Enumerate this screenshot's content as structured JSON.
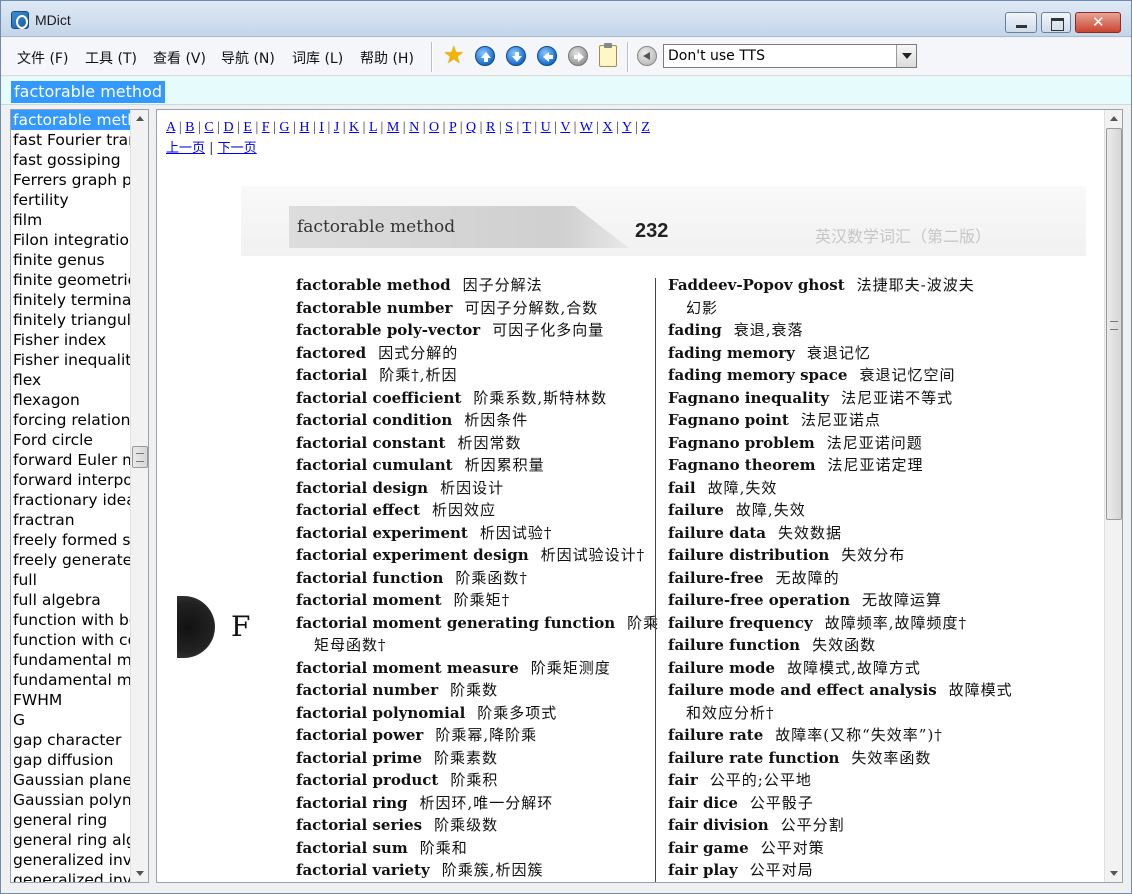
{
  "window": {
    "title": "MDict",
    "min_label": "",
    "max_label": "",
    "close_label": "✕"
  },
  "menu": {
    "file": "文件 (F)",
    "tools": "工具 (T)",
    "view": "查看 (V)",
    "nav": "导航 (N)",
    "library": "词库 (L)",
    "help": "帮助 (H)"
  },
  "toolbar": {
    "icons": [
      "star-icon",
      "arrow-up-icon",
      "arrow-down-icon",
      "back-icon",
      "forward-icon",
      "clipboard-icon",
      "speaker-icon"
    ],
    "tts_value": "Don't use TTS"
  },
  "search": {
    "value": "factorable method"
  },
  "wordlist": [
    "factorable method",
    "fast Fourier transform",
    "fast gossiping",
    "Ferrers graph paper",
    "fertility",
    "film",
    "Filon integration",
    "finite genus",
    "finite geometric",
    "finitely terminating",
    "finitely triangulable",
    "Fisher index",
    "Fisher inequality",
    "flex",
    "flexagon",
    "forcing relation",
    "Ford circle",
    "forward Euler method",
    "forward interpolation",
    "fractionary ideal",
    "fractran",
    "freely formed set",
    "freely generated",
    "full",
    "full algebra",
    "function with bounded",
    "function with compact",
    "fundamental matrix",
    "fundamental mode",
    "FWHM",
    "G",
    "gap character",
    "gap diffusion",
    "Gaussian plane",
    "Gaussian polynomial",
    "general ring",
    "general ring algebra",
    "generalized inverse",
    "generalized inverse"
  ],
  "content": {
    "alphabet": [
      "A",
      "B",
      "C",
      "D",
      "E",
      "F",
      "G",
      "H",
      "I",
      "J",
      "K",
      "L",
      "M",
      "N",
      "O",
      "P",
      "Q",
      "R",
      "S",
      "T",
      "U",
      "V",
      "W",
      "X",
      "Y",
      "Z"
    ],
    "prev_page": "上一页",
    "next_page": "下一页",
    "page_header": {
      "entry": "factorable method",
      "page_number": "232",
      "book_title": "英汉数学词汇（第二版）"
    },
    "thumb_letter": "F",
    "left_column": [
      {
        "hw": "factorable method",
        "def": "因子分解法"
      },
      {
        "hw": "factorable number",
        "def": "可因子分解数,合数"
      },
      {
        "hw": "factorable poly-vector",
        "def": "可因子化多向量"
      },
      {
        "hw": "factored",
        "def": "因式分解的"
      },
      {
        "hw": "factorial",
        "def": "阶乘†,析因"
      },
      {
        "hw": "factorial coefficient",
        "def": "阶乘系数,斯特林数"
      },
      {
        "hw": "factorial condition",
        "def": "析因条件"
      },
      {
        "hw": "factorial constant",
        "def": "析因常数"
      },
      {
        "hw": "factorial cumulant",
        "def": "析因累积量"
      },
      {
        "hw": "factorial design",
        "def": "析因设计"
      },
      {
        "hw": "factorial effect",
        "def": "析因效应"
      },
      {
        "hw": "factorial experiment",
        "def": "析因试验†"
      },
      {
        "hw": "factorial experiment design",
        "def": "析因试验设计†"
      },
      {
        "hw": "factorial function",
        "def": "阶乘函数†"
      },
      {
        "hw": "factorial moment",
        "def": "阶乘矩†"
      },
      {
        "hw": "factorial moment generating function",
        "def": "阶乘",
        "cont": "矩母函数†"
      },
      {
        "hw": "factorial moment measure",
        "def": "阶乘矩测度"
      },
      {
        "hw": "factorial number",
        "def": "阶乘数"
      },
      {
        "hw": "factorial polynomial",
        "def": "阶乘多项式"
      },
      {
        "hw": "factorial power",
        "def": "阶乘幂,降阶乘"
      },
      {
        "hw": "factorial prime",
        "def": "阶乘素数"
      },
      {
        "hw": "factorial product",
        "def": "阶乘积"
      },
      {
        "hw": "factorial ring",
        "def": "析因环,唯一分解环"
      },
      {
        "hw": "factorial series",
        "def": "阶乘级数"
      },
      {
        "hw": "factorial sum",
        "def": "阶乘和"
      },
      {
        "hw": "factorial variety",
        "def": "阶乘簇,析因簇"
      }
    ],
    "right_column": [
      {
        "hw": "Faddeev-Popov ghost",
        "def": "法捷耶夫-波波夫",
        "cont": "幻影"
      },
      {
        "hw": "fading",
        "def": "衰退,衰落"
      },
      {
        "hw": "fading memory",
        "def": "衰退记忆"
      },
      {
        "hw": "fading memory space",
        "def": "衰退记忆空间"
      },
      {
        "hw": "Fagnano inequality",
        "def": "法尼亚诺不等式"
      },
      {
        "hw": "Fagnano point",
        "def": "法尼亚诺点"
      },
      {
        "hw": "Fagnano problem",
        "def": "法尼亚诺问题"
      },
      {
        "hw": "Fagnano theorem",
        "def": "法尼亚诺定理"
      },
      {
        "hw": "fail",
        "def": "故障,失效"
      },
      {
        "hw": "failure",
        "def": "故障,失效"
      },
      {
        "hw": "failure data",
        "def": "失效数据"
      },
      {
        "hw": "failure distribution",
        "def": "失效分布"
      },
      {
        "hw": "failure-free",
        "def": "无故障的"
      },
      {
        "hw": "failure-free operation",
        "def": "无故障运算"
      },
      {
        "hw": "failure frequency",
        "def": "故障频率,故障频度†"
      },
      {
        "hw": "failure function",
        "def": "失效函数"
      },
      {
        "hw": "failure mode",
        "def": "故障模式,故障方式"
      },
      {
        "hw": "failure mode and effect analysis",
        "def": "故障模式",
        "cont": "和效应分析†"
      },
      {
        "hw": "failure rate",
        "def": "故障率(又称“失效率”)†"
      },
      {
        "hw": "failure rate function",
        "def": "失效率函数"
      },
      {
        "hw": "fair",
        "def": "公平的;公平地"
      },
      {
        "hw": "fair dice",
        "def": "公平骰子"
      },
      {
        "hw": "fair division",
        "def": "公平分割"
      },
      {
        "hw": "fair game",
        "def": "公平对策"
      },
      {
        "hw": "fair play",
        "def": "公平对局"
      }
    ]
  }
}
